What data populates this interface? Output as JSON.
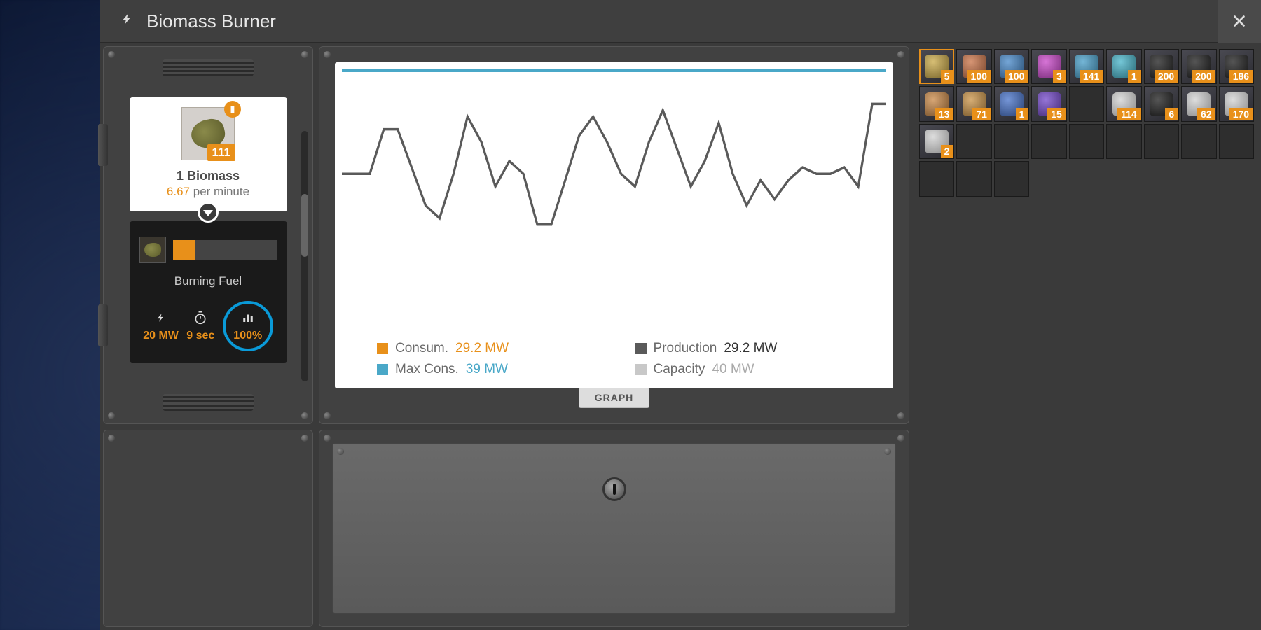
{
  "title": "Biomass Burner",
  "fuel": {
    "name": "Biomass",
    "qty_prefix": "1",
    "stack_count": "111",
    "rate_value": "6.67",
    "rate_suffix": "per minute"
  },
  "burning": {
    "label": "Burning Fuel",
    "progress_pct": 22
  },
  "stats": {
    "power": "20 MW",
    "time": "9 sec",
    "efficiency": "100%"
  },
  "graph_tab": "GRAPH",
  "legend": {
    "consum_label": "Consum.",
    "consum_value": "29.2 MW",
    "production_label": "Production",
    "production_value": "29.2 MW",
    "maxcons_label": "Max Cons.",
    "maxcons_value": "39 MW",
    "capacity_label": "Capacity",
    "capacity_value": "40 MW"
  },
  "colors": {
    "accent": "#e8901a",
    "cyan": "#4aa8c8",
    "dark": "#5a5a5a",
    "light": "#c8c8c8"
  },
  "chart_data": {
    "type": "line",
    "title": "",
    "xlabel": "",
    "ylabel": "",
    "ylim": [
      0,
      40
    ],
    "reference_lines": {
      "max_cons": 39,
      "capacity": 40
    },
    "series": [
      {
        "name": "Consumption",
        "color": "#5a5a5a",
        "values": [
          24,
          24,
          24,
          31,
          31,
          25,
          19,
          17,
          24,
          33,
          29,
          22,
          26,
          24,
          16,
          16,
          23,
          30,
          33,
          29,
          24,
          22,
          29,
          34,
          28,
          22,
          26,
          32,
          24,
          19,
          23,
          20,
          23,
          25,
          24,
          24,
          25,
          22,
          35,
          35
        ]
      }
    ]
  },
  "inventory": [
    {
      "count": "5",
      "hue": 45,
      "selected": true
    },
    {
      "count": "100",
      "hue": 20
    },
    {
      "count": "100",
      "hue": 210
    },
    {
      "count": "3",
      "hue": 300
    },
    {
      "count": "141",
      "hue": 200
    },
    {
      "count": "1",
      "hue": 190
    },
    {
      "count": "200",
      "hue": 0,
      "dark": true
    },
    {
      "count": "200",
      "hue": 0,
      "dark": true
    },
    {
      "count": "186",
      "hue": 0,
      "dark": true
    },
    {
      "count": "13",
      "hue": 30
    },
    {
      "count": "71",
      "hue": 35
    },
    {
      "count": "1",
      "hue": 220
    },
    {
      "count": "15",
      "hue": 260
    },
    null,
    {
      "count": "114",
      "hue": 0,
      "light": true
    },
    {
      "count": "6",
      "hue": 0,
      "dark": true
    },
    {
      "count": "62",
      "hue": 0,
      "light": true
    },
    {
      "count": "170",
      "hue": 210,
      "light": true
    },
    {
      "count": "2",
      "hue": 200,
      "light": true
    },
    null,
    null,
    null,
    null,
    null,
    null,
    null,
    null,
    null,
    null,
    null
  ]
}
